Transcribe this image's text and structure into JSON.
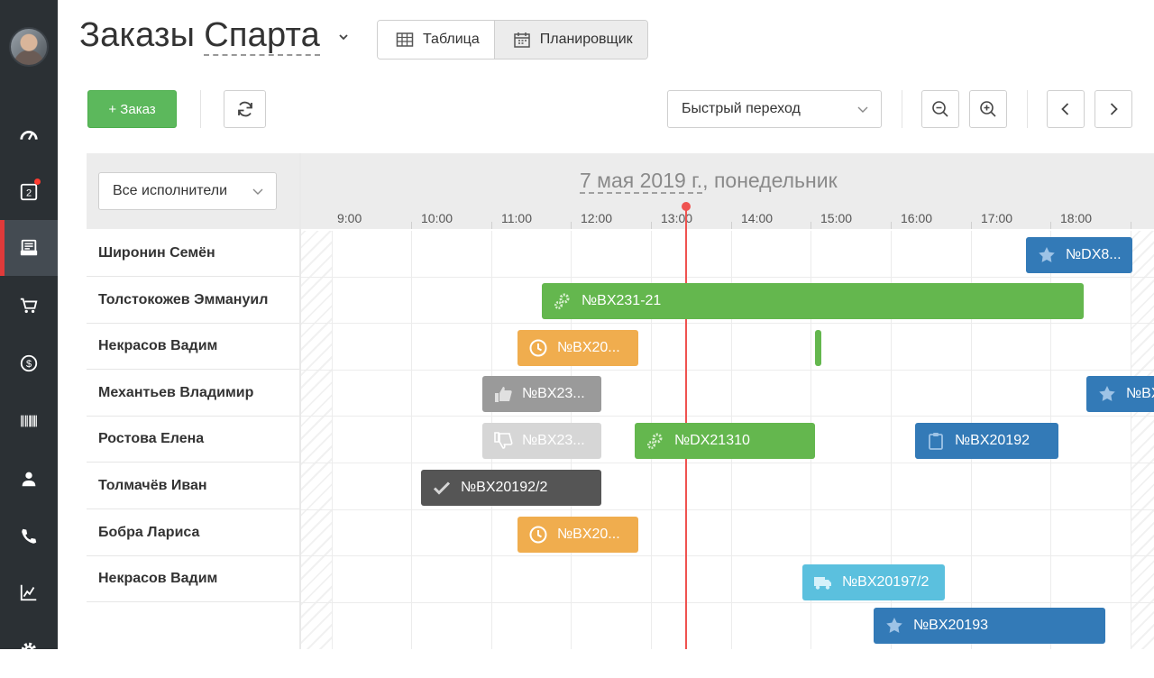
{
  "app": {
    "title": "Заказы",
    "company": "Спарта"
  },
  "views": [
    {
      "label": "Таблица",
      "icon": "table-icon",
      "active": false
    },
    {
      "label": "Планировщик",
      "icon": "calendar-icon",
      "active": true
    }
  ],
  "sidebar": {
    "items": [
      {
        "icon": "dashboard-icon",
        "active": false
      },
      {
        "icon": "tasks-badge-icon",
        "badge": "2",
        "active": false
      },
      {
        "icon": "orders-icon",
        "active": true
      },
      {
        "icon": "cart-icon",
        "active": false
      },
      {
        "icon": "dollar-icon",
        "active": false
      },
      {
        "icon": "barcode-icon",
        "active": false
      },
      {
        "icon": "user-icon",
        "active": false
      },
      {
        "icon": "phone-icon",
        "active": false
      },
      {
        "icon": "chart-icon",
        "active": false
      },
      {
        "icon": "gear-icon",
        "active": false
      }
    ]
  },
  "toolbar": {
    "add_label": "+ Заказ",
    "quick_jump": "Быстрый переход"
  },
  "scheduler": {
    "date": "7 мая 2019 г.",
    "weekday": ", понедельник",
    "filter": "Все исполнители",
    "hours": [
      "9:00",
      "10:00",
      "11:00",
      "12:00",
      "13:00",
      "14:00",
      "15:00",
      "16:00",
      "17:00",
      "18:00"
    ],
    "current_time": "13:22",
    "rows": [
      "Широнин Семён",
      "Толстокожев Эммануил",
      "Некрасов Вадим",
      "Механтьев Владимир",
      "Ростова Елена",
      "Толмачёв Иван",
      "Бобра Лариса",
      "Некрасов Вадим"
    ],
    "orders": [
      {
        "label": "№DX8...",
        "color": "#337ab7",
        "icon": "star-icon"
      },
      {
        "label": "№BX231-21",
        "color": "#64b74e",
        "icon": "gears-icon"
      },
      {
        "label": "№BX20...",
        "color": "#f0ad4e",
        "icon": "clock-icon"
      },
      {
        "label": "",
        "color": "#64b74e",
        "icon": ""
      },
      {
        "label": "№BX23...",
        "color": "#9a9a9a",
        "icon": "thumbs-up-icon"
      },
      {
        "label": "№BX",
        "color": "#337ab7",
        "icon": "star-icon"
      },
      {
        "label": "№BX23...",
        "color": "#d6d6d6",
        "icon": "thumbs-down-icon"
      },
      {
        "label": "№DX21310",
        "color": "#64b74e",
        "icon": "gears-icon"
      },
      {
        "label": "№BX20192",
        "color": "#337ab7",
        "icon": "clipboard-icon"
      },
      {
        "label": "№BX20192/2",
        "color": "#555555",
        "icon": "check-icon"
      },
      {
        "label": "№BX20...",
        "color": "#f0ad4e",
        "icon": "clock-icon"
      },
      {
        "label": "№BX20197/2",
        "color": "#5bc0de",
        "icon": "truck-icon"
      },
      {
        "label": "№BX20193",
        "color": "#337ab7",
        "icon": "star-icon"
      }
    ]
  }
}
